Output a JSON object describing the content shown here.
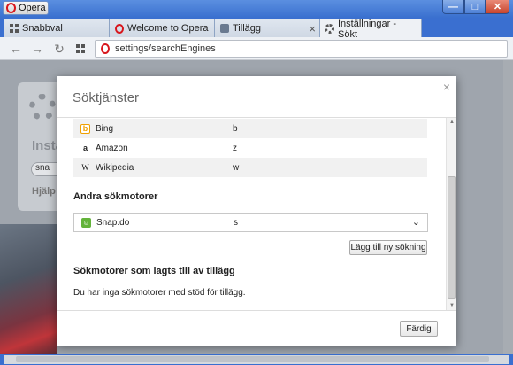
{
  "window": {
    "app_button_label": "Opera",
    "controls": {
      "minimize": "—",
      "maximize": "□",
      "close": "✕"
    }
  },
  "tabs": [
    {
      "label": "Snabbval",
      "icon": "speed-dial-grid-icon"
    },
    {
      "label": "Welcome to Opera",
      "icon": "opera-icon"
    },
    {
      "label": "Tillägg",
      "icon": "extensions-icon"
    },
    {
      "label": "Inställningar - Sökt",
      "icon": "gear-icon",
      "active": true
    }
  ],
  "new_tab_label": "+",
  "toolbar": {
    "url": "settings/searchEngines",
    "back": "←",
    "forward": "→",
    "reload": "↻"
  },
  "background_page": {
    "title": "Instä",
    "search_text": "sna",
    "help": "Hjälp"
  },
  "dialog": {
    "title": "Söktjänster",
    "close": "×",
    "engines": [
      {
        "name": "Bing",
        "keyword": "b",
        "icon": "bing-icon"
      },
      {
        "name": "Amazon",
        "keyword": "z",
        "icon": "amazon-icon"
      },
      {
        "name": "Wikipedia",
        "keyword": "w",
        "icon": "wikipedia-icon"
      }
    ],
    "other_heading": "Andra sökmotorer",
    "other_engines": [
      {
        "name": "Snap.do",
        "keyword": "s",
        "icon": "snapdo-icon"
      }
    ],
    "add_button": "Lägg till ny sökning",
    "extensions_heading": "Sökmotorer som lagts till av tillägg",
    "extensions_empty": "Du har inga sökmotorer med stöd för tillägg.",
    "done_button": "Färdig"
  },
  "colors": {
    "window_frame": "#3a6fd0",
    "opera_red": "#d8161c",
    "snap_green": "#63b33a",
    "bing_orange": "#f0a000"
  }
}
